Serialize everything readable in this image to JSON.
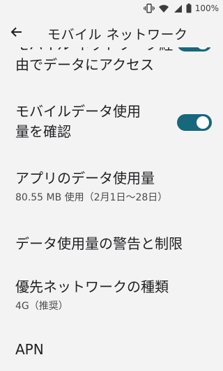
{
  "status": {
    "battery_text": "100%"
  },
  "app_bar": {
    "title": "モバイル ネットワーク"
  },
  "items": [
    {
      "title_lines": [
        "モバイル ネットワーク経",
        "由でデータにアクセス"
      ],
      "toggle_on": true
    },
    {
      "title_lines": [
        "モバイルデータ使用",
        "量を確認"
      ],
      "toggle_on": true
    },
    {
      "title": "アプリのデータ使用量",
      "summary": "80.55 MB 使用（2月1日〜28日）"
    },
    {
      "title": "データ使用量の警告と制限"
    },
    {
      "title": "優先ネットワークの種類",
      "summary": "4G（推奨）"
    },
    {
      "title": "APN"
    }
  ],
  "colors": {
    "toggle_on": "#17677d",
    "background": "#f3f3f3"
  }
}
